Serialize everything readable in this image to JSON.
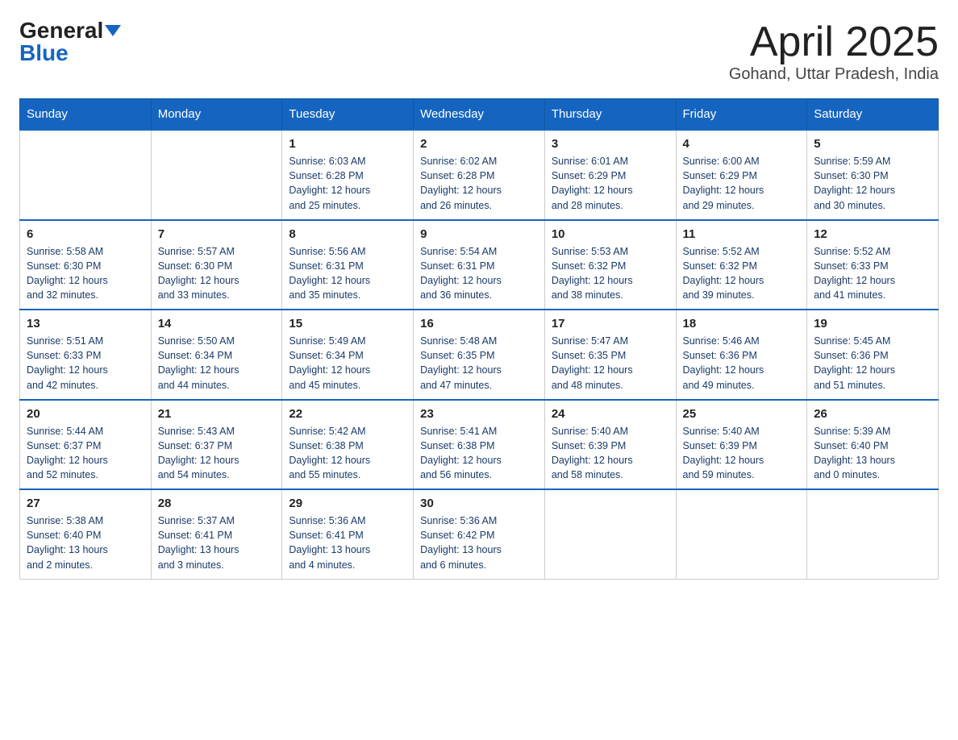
{
  "header": {
    "logo_general": "General",
    "logo_blue": "Blue",
    "title": "April 2025",
    "location": "Gohand, Uttar Pradesh, India"
  },
  "days_of_week": [
    "Sunday",
    "Monday",
    "Tuesday",
    "Wednesday",
    "Thursday",
    "Friday",
    "Saturday"
  ],
  "weeks": [
    [
      {
        "day": "",
        "info": ""
      },
      {
        "day": "",
        "info": ""
      },
      {
        "day": "1",
        "info": "Sunrise: 6:03 AM\nSunset: 6:28 PM\nDaylight: 12 hours\nand 25 minutes."
      },
      {
        "day": "2",
        "info": "Sunrise: 6:02 AM\nSunset: 6:28 PM\nDaylight: 12 hours\nand 26 minutes."
      },
      {
        "day": "3",
        "info": "Sunrise: 6:01 AM\nSunset: 6:29 PM\nDaylight: 12 hours\nand 28 minutes."
      },
      {
        "day": "4",
        "info": "Sunrise: 6:00 AM\nSunset: 6:29 PM\nDaylight: 12 hours\nand 29 minutes."
      },
      {
        "day": "5",
        "info": "Sunrise: 5:59 AM\nSunset: 6:30 PM\nDaylight: 12 hours\nand 30 minutes."
      }
    ],
    [
      {
        "day": "6",
        "info": "Sunrise: 5:58 AM\nSunset: 6:30 PM\nDaylight: 12 hours\nand 32 minutes."
      },
      {
        "day": "7",
        "info": "Sunrise: 5:57 AM\nSunset: 6:30 PM\nDaylight: 12 hours\nand 33 minutes."
      },
      {
        "day": "8",
        "info": "Sunrise: 5:56 AM\nSunset: 6:31 PM\nDaylight: 12 hours\nand 35 minutes."
      },
      {
        "day": "9",
        "info": "Sunrise: 5:54 AM\nSunset: 6:31 PM\nDaylight: 12 hours\nand 36 minutes."
      },
      {
        "day": "10",
        "info": "Sunrise: 5:53 AM\nSunset: 6:32 PM\nDaylight: 12 hours\nand 38 minutes."
      },
      {
        "day": "11",
        "info": "Sunrise: 5:52 AM\nSunset: 6:32 PM\nDaylight: 12 hours\nand 39 minutes."
      },
      {
        "day": "12",
        "info": "Sunrise: 5:52 AM\nSunset: 6:33 PM\nDaylight: 12 hours\nand 41 minutes."
      }
    ],
    [
      {
        "day": "13",
        "info": "Sunrise: 5:51 AM\nSunset: 6:33 PM\nDaylight: 12 hours\nand 42 minutes."
      },
      {
        "day": "14",
        "info": "Sunrise: 5:50 AM\nSunset: 6:34 PM\nDaylight: 12 hours\nand 44 minutes."
      },
      {
        "day": "15",
        "info": "Sunrise: 5:49 AM\nSunset: 6:34 PM\nDaylight: 12 hours\nand 45 minutes."
      },
      {
        "day": "16",
        "info": "Sunrise: 5:48 AM\nSunset: 6:35 PM\nDaylight: 12 hours\nand 47 minutes."
      },
      {
        "day": "17",
        "info": "Sunrise: 5:47 AM\nSunset: 6:35 PM\nDaylight: 12 hours\nand 48 minutes."
      },
      {
        "day": "18",
        "info": "Sunrise: 5:46 AM\nSunset: 6:36 PM\nDaylight: 12 hours\nand 49 minutes."
      },
      {
        "day": "19",
        "info": "Sunrise: 5:45 AM\nSunset: 6:36 PM\nDaylight: 12 hours\nand 51 minutes."
      }
    ],
    [
      {
        "day": "20",
        "info": "Sunrise: 5:44 AM\nSunset: 6:37 PM\nDaylight: 12 hours\nand 52 minutes."
      },
      {
        "day": "21",
        "info": "Sunrise: 5:43 AM\nSunset: 6:37 PM\nDaylight: 12 hours\nand 54 minutes."
      },
      {
        "day": "22",
        "info": "Sunrise: 5:42 AM\nSunset: 6:38 PM\nDaylight: 12 hours\nand 55 minutes."
      },
      {
        "day": "23",
        "info": "Sunrise: 5:41 AM\nSunset: 6:38 PM\nDaylight: 12 hours\nand 56 minutes."
      },
      {
        "day": "24",
        "info": "Sunrise: 5:40 AM\nSunset: 6:39 PM\nDaylight: 12 hours\nand 58 minutes."
      },
      {
        "day": "25",
        "info": "Sunrise: 5:40 AM\nSunset: 6:39 PM\nDaylight: 12 hours\nand 59 minutes."
      },
      {
        "day": "26",
        "info": "Sunrise: 5:39 AM\nSunset: 6:40 PM\nDaylight: 13 hours\nand 0 minutes."
      }
    ],
    [
      {
        "day": "27",
        "info": "Sunrise: 5:38 AM\nSunset: 6:40 PM\nDaylight: 13 hours\nand 2 minutes."
      },
      {
        "day": "28",
        "info": "Sunrise: 5:37 AM\nSunset: 6:41 PM\nDaylight: 13 hours\nand 3 minutes."
      },
      {
        "day": "29",
        "info": "Sunrise: 5:36 AM\nSunset: 6:41 PM\nDaylight: 13 hours\nand 4 minutes."
      },
      {
        "day": "30",
        "info": "Sunrise: 5:36 AM\nSunset: 6:42 PM\nDaylight: 13 hours\nand 6 minutes."
      },
      {
        "day": "",
        "info": ""
      },
      {
        "day": "",
        "info": ""
      },
      {
        "day": "",
        "info": ""
      }
    ]
  ]
}
